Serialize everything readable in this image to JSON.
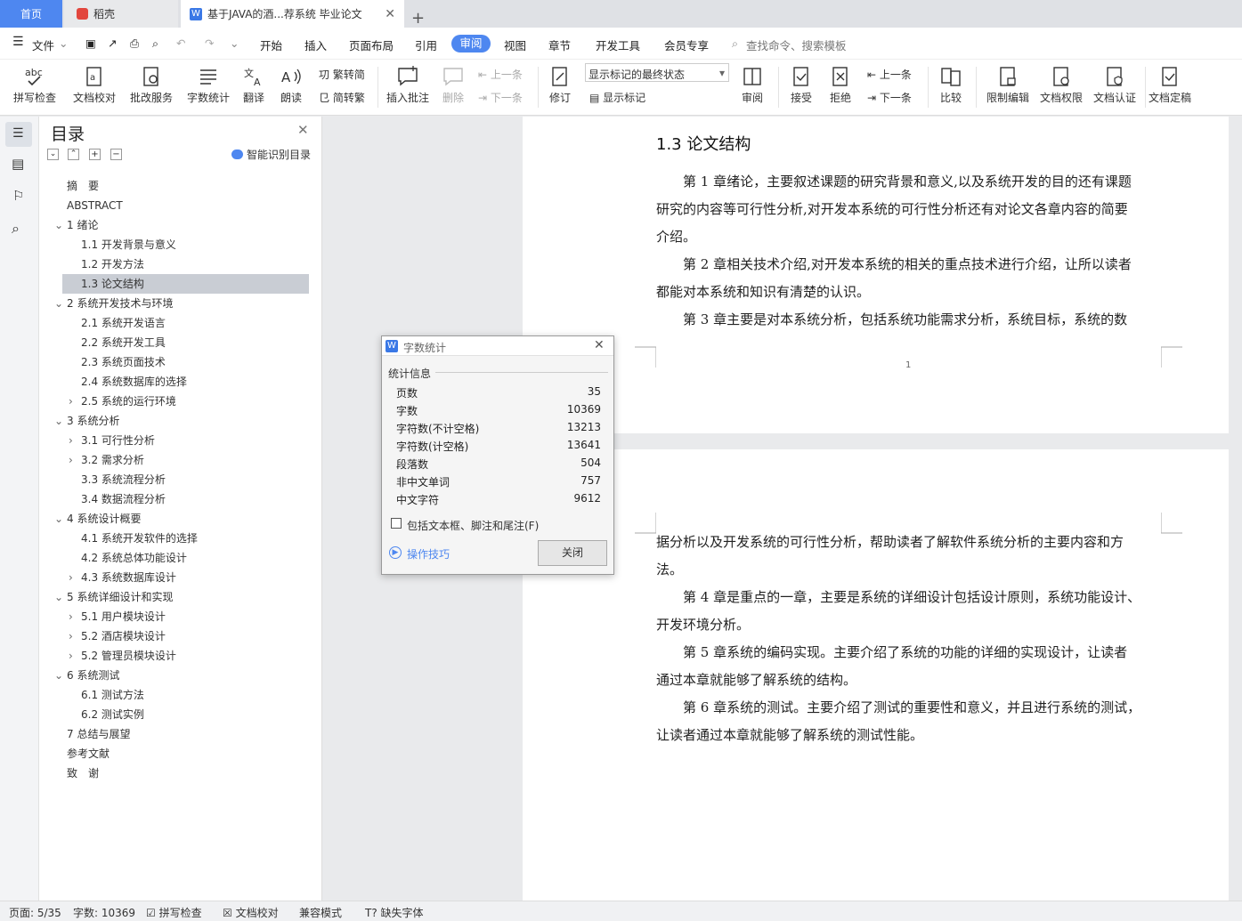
{
  "tabs": {
    "home": "首页",
    "daoke": "稻壳",
    "doc": "基于JAVA的酒...荐系统 毕业论文",
    "add": "+"
  },
  "menu": {
    "file": "文件",
    "items": [
      "开始",
      "插入",
      "页面布局",
      "引用",
      "审阅",
      "视图",
      "章节",
      "开发工具",
      "会员专享"
    ],
    "search": "查找命令、搜索模板"
  },
  "ribbon": {
    "spellcheck": "拼写检查",
    "doc_proof": "文档校对",
    "batch": "批改服务",
    "wordcount": "字数统计",
    "translate": "翻译",
    "read": "朗读",
    "trad": "繁转简",
    "simp": "简转繁",
    "insert_comment": "插入批注",
    "delete": "删除",
    "prev_c": "上一条",
    "next_c": "下一条",
    "track": "修订",
    "markup_state": "显示标记的最终状态",
    "show_markup": "显示标记",
    "review": "审阅",
    "accept": "接受",
    "reject": "拒绝",
    "prev": "上一条",
    "next": "下一条",
    "compare": "比较",
    "restrict": "限制编辑",
    "perm": "文档权限",
    "cert": "文档认证",
    "final": "文档定稿"
  },
  "toc": {
    "title": "目录",
    "smart": "智能识别目录",
    "items": [
      {
        "text": "摘　要",
        "level": 0
      },
      {
        "text": "ABSTRACT",
        "level": 0
      },
      {
        "text": "1 绪论",
        "level": 0,
        "exp": "v"
      },
      {
        "text": "1.1 开发背景与意义",
        "level": 1
      },
      {
        "text": "1.2 开发方法",
        "level": 1
      },
      {
        "text": "1.3 论文结构",
        "level": 1
      },
      {
        "text": "2 系统开发技术与环境",
        "level": 0,
        "exp": "v"
      },
      {
        "text": "2.1  系统开发语言",
        "level": 1
      },
      {
        "text": "2.2  系统开发工具",
        "level": 1
      },
      {
        "text": "2.3  系统页面技术",
        "level": 1
      },
      {
        "text": "2.4  系统数据库的选择",
        "level": 1
      },
      {
        "text": "2.5  系统的运行环境",
        "level": 1,
        "exp": ">"
      },
      {
        "text": "3  系统分析",
        "level": 0,
        "exp": "v"
      },
      {
        "text": "3.1 可行性分析",
        "level": 1,
        "exp": ">"
      },
      {
        "text": "3.2 需求分析",
        "level": 1,
        "exp": ">"
      },
      {
        "text": "3.3 系统流程分析",
        "level": 1
      },
      {
        "text": "3.4 数据流程分析",
        "level": 1
      },
      {
        "text": "4  系统设计概要",
        "level": 0,
        "exp": "v"
      },
      {
        "text": "4.1  系统开发软件的选择",
        "level": 1
      },
      {
        "text": "4.2  系统总体功能设计",
        "level": 1
      },
      {
        "text": "4.3  系统数据库设计",
        "level": 1,
        "exp": ">"
      },
      {
        "text": "5  系统详细设计和实现",
        "level": 0,
        "exp": "v"
      },
      {
        "text": "5.1  用户模块设计",
        "level": 1,
        "exp": ">"
      },
      {
        "text": "5.2  酒店模块设计",
        "level": 1,
        "exp": ">"
      },
      {
        "text": "5.2  管理员模块设计",
        "level": 1,
        "exp": ">"
      },
      {
        "text": "6  系统测试",
        "level": 0,
        "exp": "v"
      },
      {
        "text": "6.1  测试方法",
        "level": 1
      },
      {
        "text": "6.2  测试实例",
        "level": 1
      },
      {
        "text": "7  总结与展望",
        "level": 0
      },
      {
        "text": "参考文献",
        "level": 0
      },
      {
        "text": "致　谢",
        "level": 0
      }
    ]
  },
  "doc": {
    "heading": "1.3 论文结构",
    "page1_lines": [
      "　　第 1 章绪论，主要叙述课题的研究背景和意义,以及系统开发的目的还有课题",
      "研究的内容等可行性分析,对开发本系统的可行性分析还有对论文各章内容的简要",
      "介绍。",
      "　　第 2 章相关技术介绍,对开发本系统的相关的重点技术进行介绍，让所以读者",
      "都能对本系统和知识有清楚的认识。",
      "　　第 3 章主要是对本系统分析，包括系统功能需求分析，系统目标，系统的数"
    ],
    "page_num": "1",
    "page2_lines": [
      "据分析以及开发系统的可行性分析，帮助读者了解软件系统分析的主要内容和方",
      "法。",
      "　　第 4 章是重点的一章，主要是系统的详细设计包括设计原则，系统功能设计、",
      "开发环境分析。",
      "　　第 5 章系统的编码实现。主要介绍了系统的功能的详细的实现设计，让读者",
      "通过本章就能够了解系统的结构。",
      "　　第 6 章系统的测试。主要介绍了测试的重要性和意义，并且进行系统的测试，",
      "让读者通过本章就能够了解系统的测试性能。"
    ]
  },
  "dialog": {
    "title": "字数统计",
    "group": "统计信息",
    "rows": [
      {
        "k": "页数",
        "v": "35"
      },
      {
        "k": "字数",
        "v": "10369"
      },
      {
        "k": "字符数(不计空格)",
        "v": "13213"
      },
      {
        "k": "字符数(计空格)",
        "v": "13641"
      },
      {
        "k": "段落数",
        "v": "504"
      },
      {
        "k": "非中文单词",
        "v": "757"
      },
      {
        "k": "中文字符",
        "v": "9612"
      }
    ],
    "include": "包括文本框、脚注和尾注(F)",
    "tips": "操作技巧",
    "close": "关闭"
  },
  "status": {
    "page": "页面: 5/35",
    "words": "字数: 10369",
    "spell": "拼写检查",
    "proof": "文档校对",
    "compat": "兼容模式",
    "missing_font": "缺失字体"
  },
  "colors": {
    "accent": "#4e87f0",
    "brand_red": "#e2463d"
  }
}
